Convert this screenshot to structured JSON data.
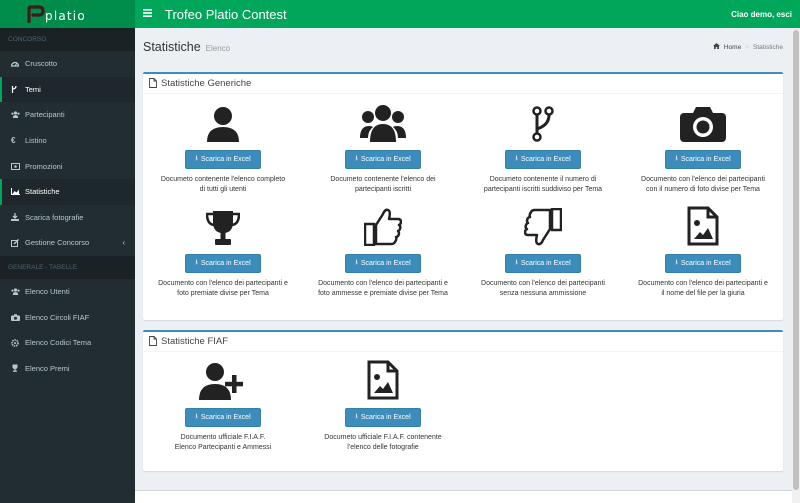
{
  "header": {
    "title": "Trofeo Platio Contest",
    "user": "Ciao demo, esci",
    "logo_text": "Platio"
  },
  "sidebar": {
    "section1": "CONCORSO",
    "section2": "GENERALE - TABELLE",
    "items": [
      {
        "label": "Cruscotto",
        "icon": "dashboard-icon"
      },
      {
        "label": "Temi",
        "icon": "branch-icon"
      },
      {
        "label": "Partecipanti",
        "icon": "users-icon"
      },
      {
        "label": "Listino",
        "icon": "euro-icon"
      },
      {
        "label": "Promozioni",
        "icon": "money-icon"
      },
      {
        "label": "Statistiche",
        "icon": "area-chart-icon"
      },
      {
        "label": "Scarica fotografie",
        "icon": "download-icon"
      },
      {
        "label": "Gestione Concorso",
        "icon": "edit-icon"
      }
    ],
    "items2": [
      {
        "label": "Elenco Utenti",
        "icon": "users-icon"
      },
      {
        "label": "Elenco Circoli FIAF",
        "icon": "camera-icon"
      },
      {
        "label": "Elenco Codici Tema",
        "icon": "gear-icon"
      },
      {
        "label": "Elenco Premi",
        "icon": "trophy-icon"
      }
    ]
  },
  "page": {
    "title": "Statistiche",
    "subtitle": "Elenco",
    "breadcrumb_home": "Home",
    "breadcrumb_current": "Statistiche"
  },
  "box1": {
    "title": "Statistiche Generiche",
    "items": [
      {
        "icon": "user-icon",
        "button": "Scarica in Excel",
        "desc": "Documeto contenente l'elenco completo\ndi tutti gli utenti"
      },
      {
        "icon": "users-icon",
        "button": "Scarica in Excel",
        "desc": "Documeto contenente l'elenco dei\npartecipanti iscritti"
      },
      {
        "icon": "code-fork-icon",
        "button": "Scarica in Excel",
        "desc": "Documeto contenente il numero di\npartecipanti iscritti suddiviso per Tema"
      },
      {
        "icon": "camera-icon",
        "button": "Scarica in Excel",
        "desc": "Documento con l'elenco dei partecipanti\ncon il numero di foto divise per Tema"
      },
      {
        "icon": "trophy-icon",
        "button": "Scarica in Excel",
        "desc": "Documento con l'elenco dei partecipanti e\nfoto premiate divise per Tema"
      },
      {
        "icon": "thumbs-up-icon",
        "button": "Scarica in Excel",
        "desc": "Documento con l'elenco dei partecipanti e\nfoto ammesse e premiate divise per Tema"
      },
      {
        "icon": "thumbs-down-icon",
        "button": "Scarica in Excel",
        "desc": "Documento con l'elenco dei partecipanti\nsenza nessuna ammissione"
      },
      {
        "icon": "file-image-icon",
        "button": "Scarica in Excel",
        "desc": "Documento con l'elenco dei partecipanti e\nil nome del file per la giuria"
      }
    ]
  },
  "box2": {
    "title": "Statistiche FIAF",
    "items": [
      {
        "icon": "user-plus-icon",
        "button": "Scarica in Excel",
        "desc": "Documento ufficiale F.I.A.F.\nElenco Partecipanti e Ammessi"
      },
      {
        "icon": "file-image-icon",
        "button": "Scarica in Excel",
        "desc": "Documeto ufficiale F.I.A.F. contenente\nl'elenco delle fotografie"
      }
    ]
  },
  "colors": {
    "header": "#00a65a",
    "sidebar": "#222d32",
    "button": "#3c8dbc"
  }
}
